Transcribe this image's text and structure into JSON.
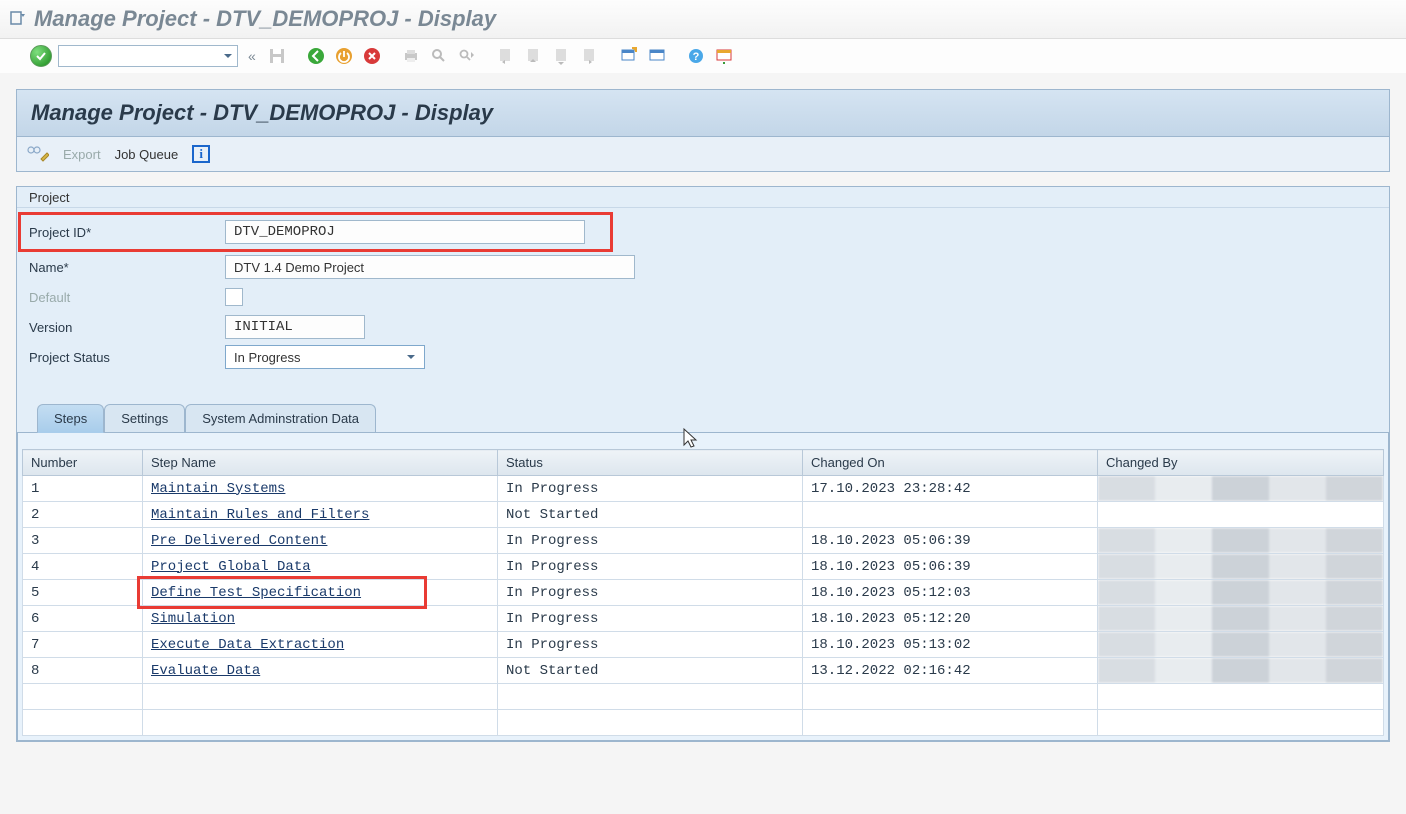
{
  "window": {
    "title": "Manage Project - DTV_DEMOPROJ  - Display"
  },
  "page": {
    "title": "Manage Project - DTV_DEMOPROJ  - Display"
  },
  "subtoolbar": {
    "export": "Export",
    "jobqueue": "Job Queue"
  },
  "project_group": {
    "title": "Project",
    "labels": {
      "project_id": "Project ID*",
      "name": "Name*",
      "default": "Default",
      "version": "Version",
      "status": "Project Status"
    },
    "values": {
      "project_id": "DTV_DEMOPROJ",
      "name": "DTV 1.4 Demo Project",
      "version": "INITIAL",
      "status": "In Progress"
    }
  },
  "tabs": {
    "steps": "Steps",
    "settings": "Settings",
    "sysadmin": "System Adminstration Data"
  },
  "grid": {
    "headers": {
      "number": "Number",
      "step": "Step Name",
      "status": "Status",
      "changed_on": "Changed On",
      "changed_by": "Changed By"
    },
    "rows": [
      {
        "n": "1",
        "name": "Maintain Systems",
        "status": "In Progress",
        "on": "17.10.2023 23:28:42"
      },
      {
        "n": "2",
        "name": "Maintain Rules and Filters",
        "status": "Not Started",
        "on": ""
      },
      {
        "n": "3",
        "name": "Pre Delivered Content",
        "status": "In Progress",
        "on": "18.10.2023 05:06:39"
      },
      {
        "n": "4",
        "name": "Project Global Data",
        "status": "In Progress",
        "on": "18.10.2023 05:06:39"
      },
      {
        "n": "5",
        "name": "Define Test Specification",
        "status": "In Progress",
        "on": "18.10.2023 05:12:03"
      },
      {
        "n": "6",
        "name": "Simulation",
        "status": "In Progress",
        "on": "18.10.2023 05:12:20"
      },
      {
        "n": "7",
        "name": "Execute Data Extraction",
        "status": "In Progress",
        "on": "18.10.2023 05:13:02"
      },
      {
        "n": "8",
        "name": "Evaluate Data",
        "status": "Not Started",
        "on": "13.12.2022 02:16:42"
      }
    ]
  }
}
